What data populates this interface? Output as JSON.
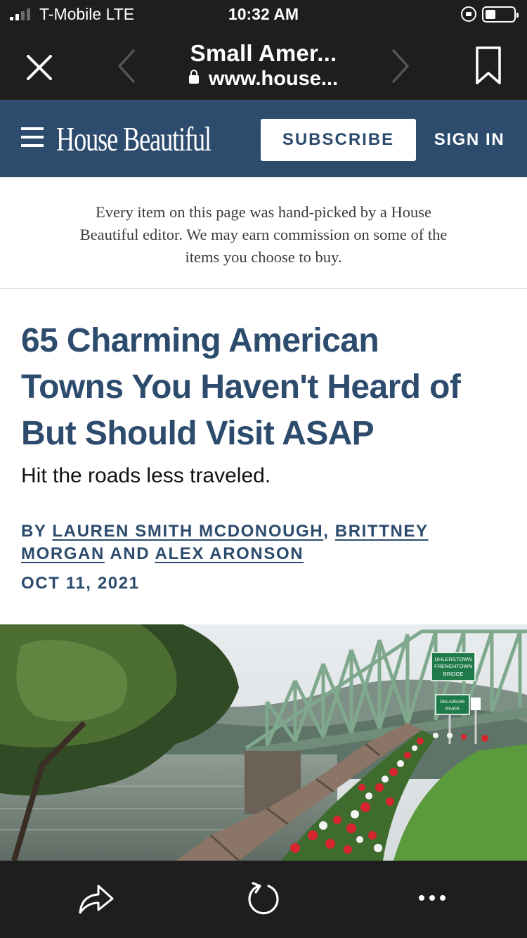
{
  "status_bar": {
    "carrier": "T-Mobile  LTE",
    "time": "10:32 AM",
    "signal_bars": 2,
    "signal_bars_total": 4
  },
  "safari": {
    "page_title": "Small Amer...",
    "url": "www.house...",
    "icons": [
      "close-icon",
      "back-chevron-icon",
      "forward-chevron-icon",
      "bookmark-icon",
      "share-icon",
      "reload-icon",
      "more-icon"
    ]
  },
  "site_header": {
    "logo": "House Beautiful",
    "subscribe_label": "SUBSCRIBE",
    "signin_label": "SIGN IN",
    "brand_color": "#2c4b6d"
  },
  "disclaimer": {
    "line1": "Every item on this page was hand-picked by a House",
    "line2": "Beautiful editor. We may earn commission on some of the",
    "line3": "items you choose to buy."
  },
  "article": {
    "headline_line1": "65 Charming American",
    "headline_line2": "Towns You Haven't Heard of",
    "headline_line3": "But Should Visit ASAP",
    "dek": "Hit the roads less traveled.",
    "byline": {
      "by": "BY",
      "author1": "LAUREN SMITH MCDONOUGH",
      "author2_part1": "BRITTNEY",
      "author2_part2": "MORGAN",
      "and": "AND",
      "author3": "ALEX ARONSON"
    },
    "date": "OCT 11, 2021"
  },
  "hero_image": {
    "signs": {
      "bridge_line1": "UHLERSTOWN",
      "bridge_line2": "FRENCHTOWN",
      "bridge_line3": "BRIDGE",
      "river_line1": "DELAWARE",
      "river_line2": "RIVER"
    }
  }
}
